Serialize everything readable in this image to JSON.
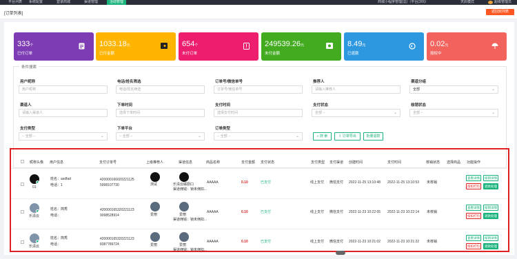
{
  "topnav": {
    "tabs": [
      "平台列表",
      "系统配置",
      "登录商城",
      "渠道管理",
      "活动管理"
    ],
    "active_tab": "活动管理",
    "right": [
      "商城小程序管理(总)（平台(3/9)）",
      "天辰模式",
      "超级管理员"
    ]
  },
  "breadcrumb": "[订单列表]",
  "return_button": "返回双列表",
  "cards": [
    {
      "value": "333",
      "unit": "个",
      "label": "已付订单",
      "color": "#7d3cb3",
      "icon": "doc-icon"
    },
    {
      "value": "1033.18",
      "unit": "元",
      "label": "已付金额",
      "color": "#ffb400",
      "icon": "wallet-icon"
    },
    {
      "value": "654",
      "unit": "个",
      "label": "未付订单",
      "color": "#ec1e6d",
      "icon": "alert-doc-icon"
    },
    {
      "value": "249539.26",
      "unit": "元",
      "label": "未付金额",
      "color": "#42ab1f",
      "icon": "money-icon"
    },
    {
      "value": "8.49",
      "unit": "元",
      "label": "已退款",
      "color": "#2d98e0",
      "icon": "refund-icon"
    },
    {
      "value": "0.02",
      "unit": "元",
      "label": "授权中",
      "color": "#f2635e",
      "icon": "umbrella-icon"
    }
  ],
  "filter": {
    "title": "条件搜索",
    "fields": [
      {
        "label": "用户昵称",
        "placeholder": "用户昵称",
        "dd": false
      },
      {
        "label": "电话/姓名筛选",
        "placeholder": "电话/姓名筛选",
        "dd": false
      },
      {
        "label": "订单号/微信单号",
        "placeholder": "订单号/微信单号",
        "dd": false
      },
      {
        "label": "推荐人",
        "placeholder": "请输入推荐人",
        "dd": false
      },
      {
        "label": "渠道分组",
        "placeholder": "全部",
        "dd": true
      },
      {
        "label": "渠道人",
        "placeholder": "请输入渠道人",
        "dd": false
      },
      {
        "label": "下单时间",
        "placeholder": "选择下单时间",
        "dd": false
      },
      {
        "label": "支付时间",
        "placeholder": "选择支付时间",
        "dd": false
      },
      {
        "label": "支付状态",
        "placeholder": "全部 --",
        "dd": true
      },
      {
        "label": "核销状态",
        "placeholder": "全部 --",
        "dd": true
      },
      {
        "label": "支付类型",
        "placeholder": "-- 全部 --",
        "dd": true
      },
      {
        "label": "下单平台",
        "placeholder": "-- 全部 --",
        "dd": true
      },
      {
        "label": "订单类型",
        "placeholder": "-- 全部 --",
        "dd": true
      }
    ],
    "buttons": [
      "搜 索",
      "订单导出",
      "批量退款"
    ]
  },
  "table": {
    "headers": [
      "昵称头像",
      "用户信息",
      "支付订单号",
      "上级推荐人",
      "渠道信息",
      "商品名称",
      "支付金额",
      "支付状态",
      "支付类型",
      "支付渠道",
      "创建时间",
      "支付时间",
      "核销状态",
      "选择商品",
      "功能操作"
    ],
    "rows": [
      {
        "nick": "01",
        "name": "姓名：asdfad",
        "phone": "电话：1",
        "order1": "420000166020221125",
        "order2": "5998107730",
        "ref": "测试",
        "ch1": "乐清云磁厨口",
        "ch2": "渠道佣钱：锁未佣扣...",
        "product": "AAAAA",
        "amount": "0.10",
        "status": "已支付",
        "ptype": "线上支付",
        "pchannel": "微信支付",
        "created": "2022-11-25 13:10:48",
        "paid": "2022-11-25 13:10:53",
        "verify": "未核销"
      },
      {
        "nick": "乐清云",
        "name": "姓名：简秀",
        "phone": "电话：",
        "order1": "420000165320221123",
        "order2": "9098528914",
        "ref": "爱丽",
        "ch1": "爱丽",
        "ch2": "渠道佣钱：锁未佣扣...",
        "product": "AAAAA",
        "amount": "0.10",
        "status": "已支付",
        "ptype": "线上支付",
        "pchannel": "微信支付",
        "created": "2022-11-23 10:22:05",
        "paid": "2022-11-23 10:22:14",
        "verify": "未核销"
      },
      {
        "nick": "乐清云",
        "name": "姓名：简秀",
        "phone": "电话：",
        "order1": "420000165320221123",
        "order2": "8387789724",
        "ref": "爱丽",
        "ch1": "爱丽",
        "ch2": "渠道佣钱：锁未佣扣...",
        "product": "AAAAA",
        "amount": "0.10",
        "status": "已支付",
        "ptype": "线上支付",
        "pchannel": "微信支付",
        "created": "2022-11-23 10:21:02",
        "paid": "2022-11-23 10:21:22",
        "verify": "未核销"
      }
    ],
    "actions": [
      "查看详情",
      "核销详情",
      "扣扣打包",
      "退款处理"
    ]
  }
}
